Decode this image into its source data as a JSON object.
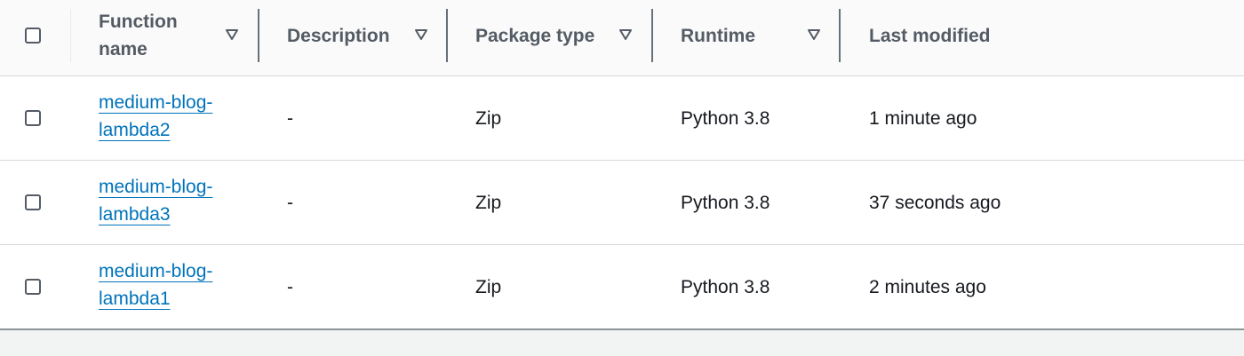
{
  "table": {
    "columns": [
      {
        "key": "function_name",
        "label_line1": "Function",
        "label_line2": "name"
      },
      {
        "key": "description",
        "label": "Description"
      },
      {
        "key": "package_type",
        "label": "Package type"
      },
      {
        "key": "runtime",
        "label": "Runtime"
      },
      {
        "key": "last_modified",
        "label": "Last modified"
      }
    ],
    "rows": [
      {
        "name_line1": "medium-blog-",
        "name_line2": "lambda2",
        "description": "-",
        "package_type": "Zip",
        "runtime": "Python 3.8",
        "last_modified": "1 minute ago",
        "selected": false
      },
      {
        "name_line1": "medium-blog-",
        "name_line2": "lambda3",
        "description": "-",
        "package_type": "Zip",
        "runtime": "Python 3.8",
        "last_modified": "37 seconds ago",
        "selected": false
      },
      {
        "name_line1": "medium-blog-",
        "name_line2": "lambda1",
        "description": "-",
        "package_type": "Zip",
        "runtime": "Python 3.8",
        "last_modified": "2 minutes ago",
        "selected": false
      }
    ]
  },
  "icons": {
    "sort": "sort-caret-down-icon"
  },
  "colors": {
    "link": "#0073bb",
    "header_text": "#545b64"
  }
}
